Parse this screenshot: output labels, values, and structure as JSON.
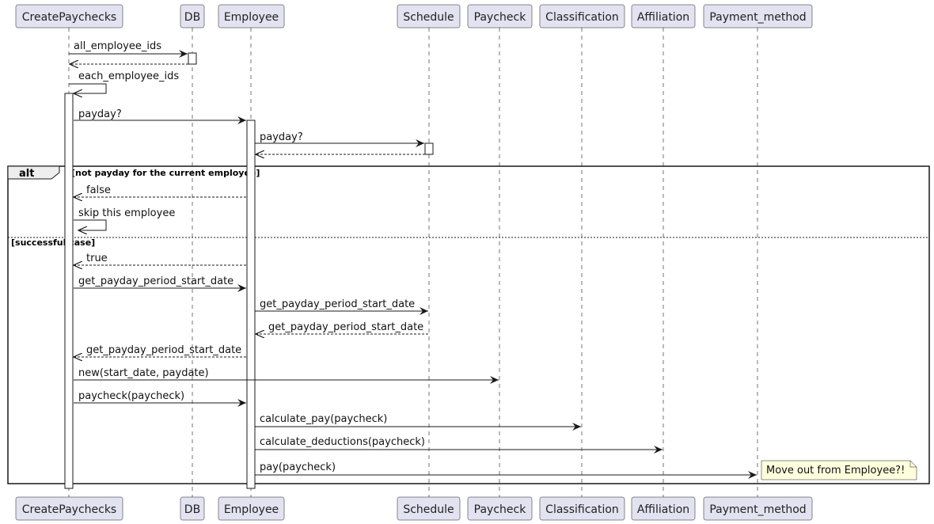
{
  "participants": [
    {
      "id": "createpaychecks",
      "label": "CreatePaychecks"
    },
    {
      "id": "db",
      "label": "DB"
    },
    {
      "id": "employee",
      "label": "Employee"
    },
    {
      "id": "schedule",
      "label": "Schedule"
    },
    {
      "id": "paycheck",
      "label": "Paycheck"
    },
    {
      "id": "classification",
      "label": "Classification"
    },
    {
      "id": "affiliation",
      "label": "Affiliation"
    },
    {
      "id": "payment_method",
      "label": "Payment_method"
    }
  ],
  "messages": [
    {
      "from": "createpaychecks",
      "to": "db",
      "label": "all_employee_ids",
      "type": "sync"
    },
    {
      "from": "db",
      "to": "createpaychecks",
      "label": "",
      "type": "return"
    },
    {
      "from": "createpaychecks",
      "to": "createpaychecks",
      "label": "each_employee_ids",
      "type": "self"
    },
    {
      "from": "createpaychecks",
      "to": "employee",
      "label": "payday?",
      "type": "sync"
    },
    {
      "from": "employee",
      "to": "schedule",
      "label": "payday?",
      "type": "sync"
    },
    {
      "from": "schedule",
      "to": "employee",
      "label": "",
      "type": "return"
    },
    {
      "from": "employee",
      "to": "createpaychecks",
      "label": "false",
      "type": "return"
    },
    {
      "from": "createpaychecks",
      "to": "createpaychecks",
      "label": "skip this employee",
      "type": "self"
    },
    {
      "from": "employee",
      "to": "createpaychecks",
      "label": "true",
      "type": "return"
    },
    {
      "from": "createpaychecks",
      "to": "employee",
      "label": "get_payday_period_start_date",
      "type": "sync"
    },
    {
      "from": "employee",
      "to": "schedule",
      "label": "get_payday_period_start_date",
      "type": "sync"
    },
    {
      "from": "schedule",
      "to": "employee",
      "label": "get_payday_period_start_date",
      "type": "return"
    },
    {
      "from": "employee",
      "to": "createpaychecks",
      "label": "get_payday_period_start_date",
      "type": "return"
    },
    {
      "from": "createpaychecks",
      "to": "paycheck",
      "label": "new(start_date, paydate)",
      "type": "sync"
    },
    {
      "from": "createpaychecks",
      "to": "employee",
      "label": "paycheck(paycheck)",
      "type": "sync"
    },
    {
      "from": "employee",
      "to": "classification",
      "label": "calculate_pay(paycheck)",
      "type": "sync"
    },
    {
      "from": "employee",
      "to": "affiliation",
      "label": "calculate_deductions(paycheck)",
      "type": "sync"
    },
    {
      "from": "employee",
      "to": "payment_method",
      "label": "pay(paycheck)",
      "type": "sync"
    }
  ],
  "alt": {
    "keyword": "alt",
    "guard1": "[not payday for the current employee]",
    "guard2": "[successful case]"
  },
  "note": {
    "text": "Move out from Employee?!"
  },
  "colors": {
    "participant_fill": "#E2E2F0",
    "participant_stroke": "#181818",
    "note_fill": "#FEFFDD",
    "line": "#181818"
  }
}
